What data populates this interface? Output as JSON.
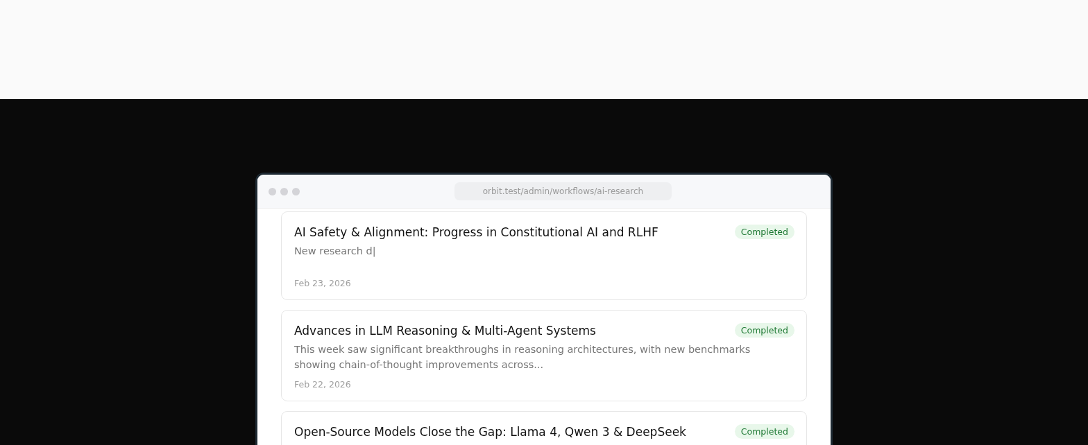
{
  "browser": {
    "url": "orbit.test/admin/workflows/ai-research"
  },
  "reports": [
    {
      "title": "AI Safety & Alignment: Progress in Constitutional AI and RLHF",
      "status": "Completed",
      "kind": "completed",
      "summary": "New research d|",
      "date": "Feb 23, 2026"
    },
    {
      "title": "Advances in LLM Reasoning & Multi-Agent Systems",
      "status": "Completed",
      "kind": "completed",
      "summary": "This week saw significant breakthroughs in reasoning architectures, with new benchmarks showing chain-of-thought improvements across...",
      "date": "Feb 22, 2026"
    },
    {
      "title": "Open-Source Models Close the Gap: Llama 4, Qwen 3 & DeepSeek",
      "status": "Completed",
      "kind": "completed"
    }
  ]
}
